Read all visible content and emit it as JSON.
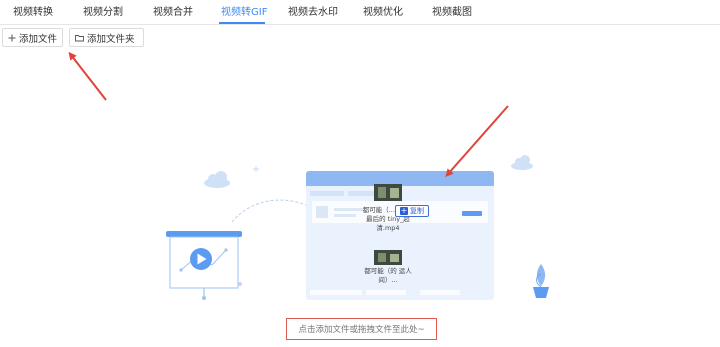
{
  "tabs": [
    {
      "label": "视频转换"
    },
    {
      "label": "视频分割"
    },
    {
      "label": "视频合并"
    },
    {
      "label": "视频转GIF"
    },
    {
      "label": "视频去水印"
    },
    {
      "label": "视频优化"
    },
    {
      "label": "视频截图"
    }
  ],
  "active_tab": "视频转GIF",
  "toolbar": {
    "add_file_label": "添加文件",
    "add_folder_label": "添加文件夹"
  },
  "drag_preview": {
    "copy_label": "复制",
    "file1_name": "都可能（... 人间）最后的 tiny_超清.mp4",
    "file2_name": "都可能（的 运人间）..."
  },
  "drop_hint": "点击添加文件或拖拽文件至此处~",
  "colors": {
    "accent": "#3d8bf2",
    "annotation_red": "#e0443a",
    "illustration_blue": "#5b9cf2"
  }
}
